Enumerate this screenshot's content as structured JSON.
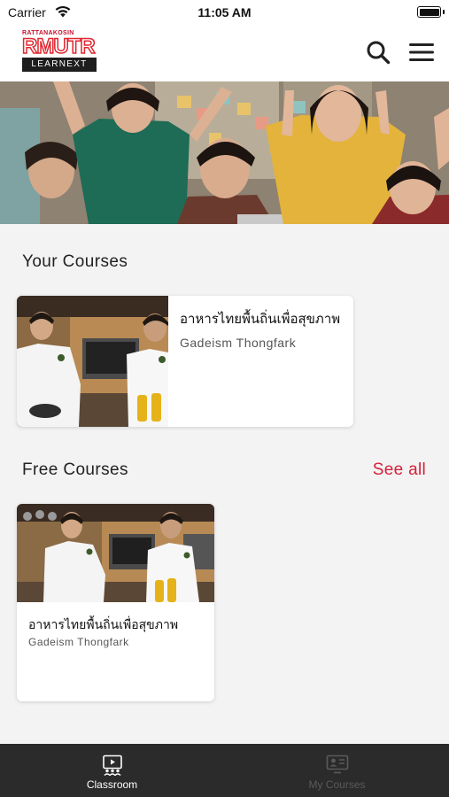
{
  "status_bar": {
    "carrier": "Carrier",
    "time": "11:05 AM"
  },
  "header": {
    "logo_top": "RATTANAKOSIN",
    "logo_main": "RMUTR",
    "logo_sub": "LEARNEXT",
    "search_icon": "search-icon",
    "menu_icon": "hamburger-menu-icon"
  },
  "sections": {
    "your_courses": "Your Courses",
    "free_courses": "Free Courses",
    "see_all": "See all"
  },
  "your_courses": [
    {
      "title": "อาหารไทยพื้นถิ่นเพื่อสุขภาพ",
      "author": "Gadeism Thongfark"
    }
  ],
  "free_courses": [
    {
      "title": "อาหารไทยพื้นถิ่นเพื่อสุขภาพ",
      "author": "Gadeism Thongfark"
    }
  ],
  "tabs": [
    {
      "label": "Classroom",
      "icon": "classroom-icon",
      "active": true
    },
    {
      "label": "My Courses",
      "icon": "my-courses-icon",
      "active": false
    }
  ],
  "colors": {
    "accent": "#d61f3a",
    "tabbar": "#2b2b2b"
  }
}
